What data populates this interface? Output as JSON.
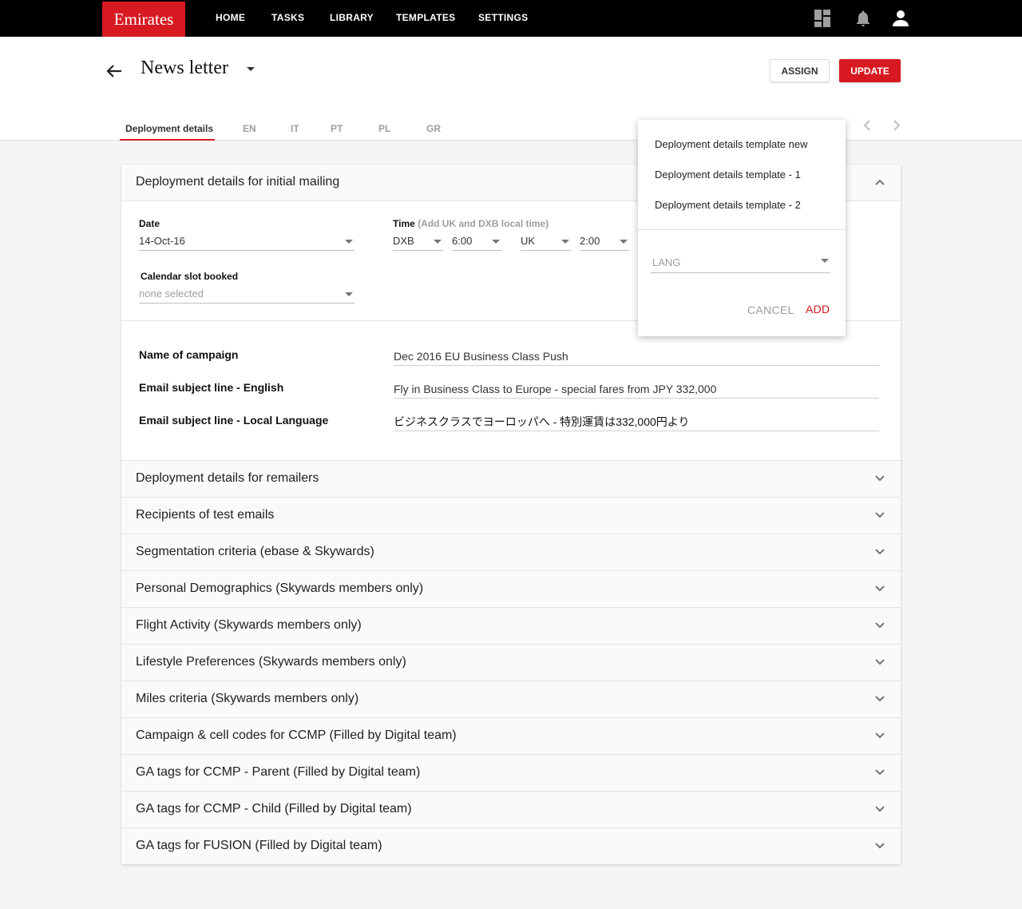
{
  "app": {
    "logo": "Emirates"
  },
  "nav": {
    "items": [
      "HOME",
      "TASKS",
      "LIBRARY",
      "TEMPLATES",
      "SETTINGS"
    ]
  },
  "header": {
    "title": "News letter",
    "assign_label": "ASSIGN",
    "update_label": "UPDATE",
    "tabs": [
      "Deployment details",
      "EN",
      "IT",
      "PT",
      "PL",
      "GR"
    ],
    "active_tab": "Deployment details"
  },
  "first_section": {
    "title": "Deployment details for initial mailing",
    "date": {
      "label": "Date",
      "value": "14-Oct-16"
    },
    "time": {
      "label": "Time",
      "hint": "(Add UK and DXB local time)",
      "zone1": "DXB",
      "time1": "6:00",
      "zone2": "UK",
      "time2": "2:00"
    },
    "calendar": {
      "label": "Calendar slot booked",
      "placeholder": "none selected"
    },
    "campaign": {
      "label": "Name of campaign",
      "value": "Dec 2016 EU Business Class Push"
    },
    "subject_en": {
      "label": "Email subject line - English",
      "value": "Fly in Business Class to Europe - special fares from JPY 332,000"
    },
    "subject_local": {
      "label": "Email subject line - Local Language",
      "value": "ビジネスクラスでヨーロッパへ - 特別運賃は332,000円より"
    }
  },
  "sections": [
    "Deployment details for remailers",
    "Recipients of test emails",
    "Segmentation criteria (ebase & Skywards)",
    "Personal Demographics (Skywards members only)",
    "Flight Activity (Skywards members only)",
    "Lifestyle Preferences  (Skywards members only)",
    "Miles criteria (Skywards members only)",
    "Campaign & cell codes for CCMP (Filled by Digital team)",
    "GA tags for CCMP - Parent (Filled by Digital team)",
    "GA tags for CCMP - Child (Filled by Digital team)",
    "GA tags for FUSION (Filled by Digital team)"
  ],
  "menu": {
    "items": [
      "Deployment details template new",
      "Deployment details template - 1",
      "Deployment details template - 2"
    ],
    "lang_placeholder": "LANG",
    "cancel_label": "CANCEL",
    "add_label": "ADD"
  },
  "colors": {
    "brand": "#d71921",
    "topbar": "#000000",
    "background": "#f5f5f5"
  },
  "icons": [
    "dashboard-icon",
    "bell-icon",
    "account-icon",
    "back-arrow-icon",
    "chevron-left-icon",
    "chevron-right-icon",
    "chevron-up-icon",
    "chevron-down-icon"
  ]
}
